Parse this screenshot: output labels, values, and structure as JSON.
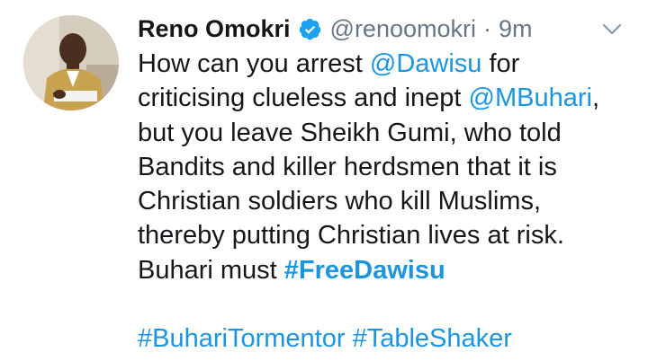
{
  "author": {
    "display_name": "Reno Omokri",
    "handle": "@renoomokri",
    "separator": "·",
    "time": "9m"
  },
  "tweet": {
    "l1_a": "How can you arrest ",
    "l1_mention": "@Dawisu",
    "l1_b": " for",
    "l2_a": "criticising clueless and inept ",
    "l2_mention": "@MBuhari",
    "l2_b": ",",
    "l3": "but you leave Sheikh Gumi, who told",
    "l4": "Bandits and killer herdsmen that it is",
    "l5": "Christian soldiers who kill Muslims,",
    "l6": "thereby putting Christian lives at risk.",
    "l7_a": "Buhari must ",
    "l7_hashtag": "#FreeDawisu",
    "l9_hashtag1": "#BuhariTormentor",
    "l9_space": " ",
    "l9_hashtag2": "#TableShaker"
  },
  "icons": {
    "verified": "verified-badge-icon",
    "menu": "chevron-down-icon"
  },
  "colors": {
    "link": "#1b95e0",
    "text": "#14171a",
    "muted": "#657786",
    "verified": "#1da1f2"
  }
}
